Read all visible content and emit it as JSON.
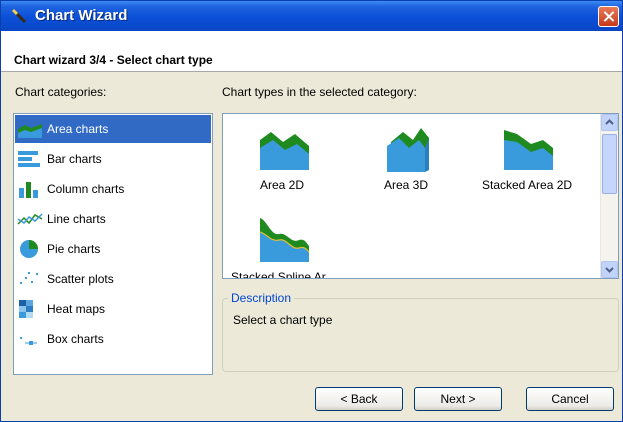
{
  "window": {
    "title": "Chart Wizard"
  },
  "header": {
    "step_title": "Chart wizard 3/4 - Select chart type"
  },
  "labels": {
    "categories": "Chart categories:",
    "types": "Chart types in the selected category:"
  },
  "categories": [
    {
      "label": "Area charts",
      "icon": "area-chart-icon",
      "selected": true
    },
    {
      "label": "Bar charts",
      "icon": "bar-chart-icon"
    },
    {
      "label": "Column charts",
      "icon": "column-chart-icon"
    },
    {
      "label": "Line charts",
      "icon": "line-chart-icon"
    },
    {
      "label": "Pie charts",
      "icon": "pie-chart-icon"
    },
    {
      "label": "Scatter plots",
      "icon": "scatter-plot-icon"
    },
    {
      "label": "Heat maps",
      "icon": "heat-map-icon"
    },
    {
      "label": "Box charts",
      "icon": "box-chart-icon"
    }
  ],
  "chart_types": [
    {
      "label": "Area 2D"
    },
    {
      "label": "Area 3D"
    },
    {
      "label": "Stacked Area 2D"
    },
    {
      "label": "Stacked Spline Ar..."
    }
  ],
  "description": {
    "legend": "Description",
    "text": "Select a chart type"
  },
  "buttons": {
    "back": "Back",
    "back_prefix": "< ",
    "next": "Next >",
    "cancel": "Cancel"
  },
  "colors": {
    "title_bar": "#0b4fd8",
    "selection": "#316ac5",
    "legend_text": "#0046d5",
    "area_blue": "#3a9bdc",
    "area_green": "#1f8a1f"
  }
}
